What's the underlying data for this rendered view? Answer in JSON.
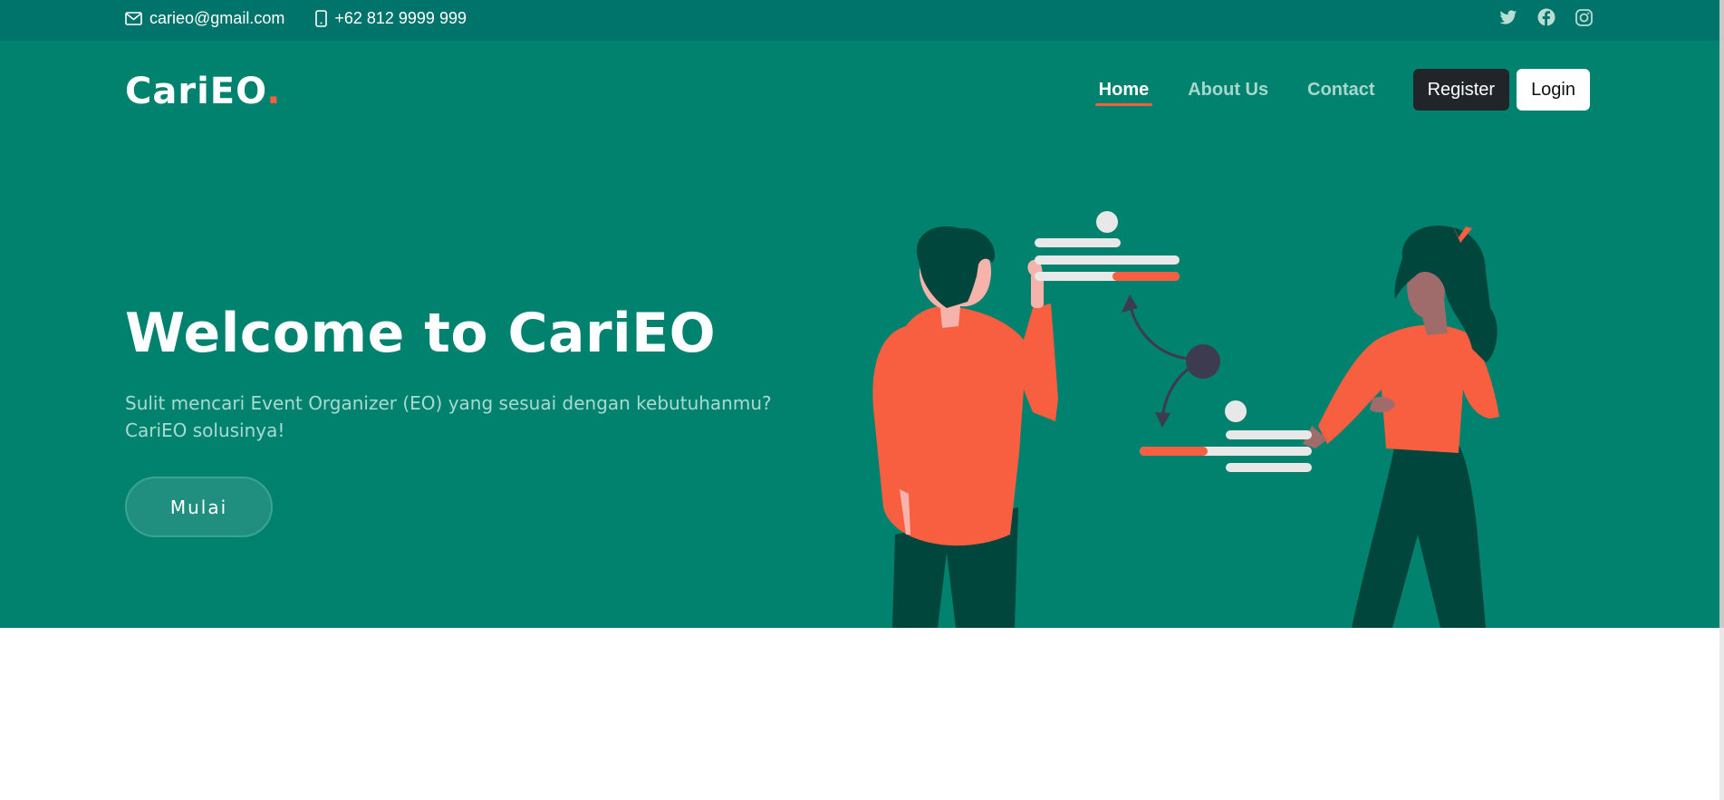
{
  "topbar": {
    "email": "carieo@gmail.com",
    "phone": "+62 812 9999 999",
    "icons": {
      "email": "envelope-icon",
      "phone": "phone-icon",
      "twitter": "twitter-icon",
      "facebook": "facebook-icon",
      "instagram": "instagram-icon"
    }
  },
  "header": {
    "logo": "CariEO",
    "logo_dot": ".",
    "nav": [
      {
        "label": "Home",
        "active": true
      },
      {
        "label": "About Us",
        "active": false
      },
      {
        "label": "Contact",
        "active": false
      }
    ],
    "register_label": "Register",
    "login_label": "Login"
  },
  "hero": {
    "title": "Welcome to CariEO",
    "subtitle": "Sulit mencari Event Organizer (EO) yang sesuai dengan kebutuhanmu? CariEO solusinya!",
    "cta_label": "Mulai"
  },
  "colors": {
    "topbar_bg": "#00736a",
    "hero_bg": "#00826f",
    "accent": "#f2603f",
    "dark_button": "#212529"
  }
}
